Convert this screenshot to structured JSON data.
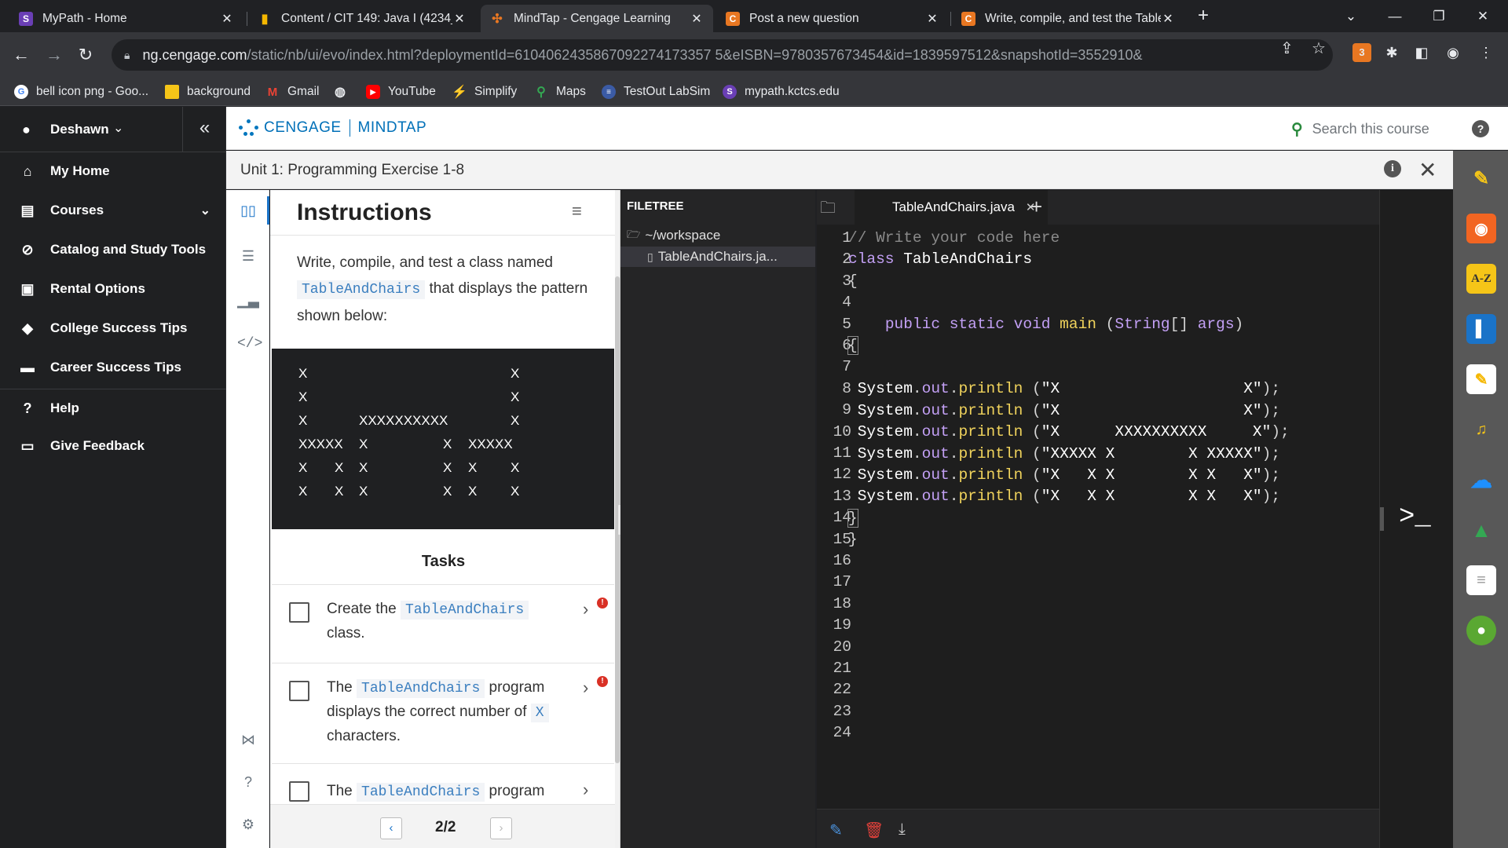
{
  "browser": {
    "tabs": [
      {
        "title": "MyPath - Home",
        "favicon": "mypath-icon",
        "active": false
      },
      {
        "title": "Content / CIT 149: Java I (4234_9",
        "favicon": "bars-icon",
        "active": false
      },
      {
        "title": "MindTap - Cengage Learning",
        "favicon": "cengage-icon",
        "active": true
      },
      {
        "title": "Post a new question",
        "favicon": "chegg-icon",
        "active": false
      },
      {
        "title": "Write, compile, and test the Table",
        "favicon": "chegg-icon",
        "active": false
      }
    ],
    "url_host": "ng.cengage.com",
    "url_path": "/static/nb/ui/evo/index.html?deploymentId=6104062435867092274173357 5&eISBN=9780357673454&id=1839597512&snapshotId=3552910&",
    "bookmarks": [
      {
        "label": "bell icon png - Goo...",
        "icon": "google-icon"
      },
      {
        "label": "background",
        "icon": "folder-icon"
      },
      {
        "label": "Gmail",
        "icon": "gmail-icon"
      },
      {
        "label": "",
        "icon": "globe-icon"
      },
      {
        "label": "YouTube",
        "icon": "youtube-icon"
      },
      {
        "label": "Simplify",
        "icon": "simplify-icon"
      },
      {
        "label": "Maps",
        "icon": "maps-icon"
      },
      {
        "label": "TestOut LabSim",
        "icon": "testout-icon"
      },
      {
        "label": "mypath.kctcs.edu",
        "icon": "mypath-icon"
      }
    ],
    "extension_badge": "3"
  },
  "leftnav": {
    "user": "Deshawn",
    "items": [
      {
        "label": "My Home",
        "icon": "home-icon"
      },
      {
        "label": "Courses",
        "icon": "book-icon"
      },
      {
        "label": "Catalog and Study Tools",
        "icon": "compass-icon"
      },
      {
        "label": "Rental Options",
        "icon": "rental-icon"
      },
      {
        "label": "College Success Tips",
        "icon": "grad-cap-icon"
      },
      {
        "label": "Career Success Tips",
        "icon": "briefcase-icon"
      },
      {
        "label": "Help",
        "icon": "help-icon"
      },
      {
        "label": "Give Feedback",
        "icon": "feedback-icon"
      }
    ]
  },
  "header": {
    "brand_1": "CENGAGE",
    "brand_2": "MINDTAP",
    "search_placeholder": "Search this course",
    "help": "?"
  },
  "subheader": {
    "title": "Unit 1: Programming Exercise 1-8"
  },
  "instructions": {
    "heading": "Instructions",
    "text_1": "Write, compile, and test a class named",
    "class_name": "TableAndChairs",
    "text_2": " that displays the pattern shown below:",
    "pattern_rows": [
      "X                         X",
      "X                         X",
      "X       XXXXXXXXXX       X",
      "XXXXX   X          X   XXXXX",
      "X    X   X          X   X    X",
      "X    X   X          X   X    X"
    ],
    "tasks_title": "Tasks",
    "tasks": [
      {
        "pre": "Create the ",
        "code": "TableAndChairs",
        "post": " class.",
        "badge": "!"
      },
      {
        "pre": "The ",
        "code": "TableAndChairs",
        "post": " program displays the correct number of ",
        "code2": "X",
        "post2": " characters.",
        "badge": "!"
      },
      {
        "pre": "The ",
        "code": "TableAndChairs",
        "post": " program",
        "badge": ""
      }
    ],
    "pager": "2/2"
  },
  "filetree": {
    "title": "FILETREE",
    "folder": "~/workspace",
    "file": "TableAndChairs.ja..."
  },
  "editor": {
    "tab": "TableAndChairs.java",
    "line_numbers": [
      "1",
      "2",
      "3",
      "4",
      "5",
      "6",
      "7",
      "8",
      "9",
      "10",
      "11",
      "12",
      "13",
      "14",
      "15",
      "16",
      "17",
      "18",
      "19",
      "20",
      "21",
      "22",
      "23",
      "24"
    ],
    "lines": [
      "// Write your code here",
      "class TableAndChairs",
      "{",
      "",
      "    public static void main (String[] args)",
      "{",
      "",
      " System.out.println (\"X                    X\");",
      " System.out.println (\"X                    X\");",
      " System.out.println (\"X      XXXXXXXXXX     X\");",
      " System.out.println (\"XXXXX X        X XXXXX\");",
      " System.out.println (\"X   X X        X X   X\");",
      " System.out.println (\"X   X X        X X   X\");",
      "}",
      "}"
    ]
  },
  "rightrail": {
    "apps": [
      "pencil-app-icon",
      "rss-app-icon",
      "az-app-icon",
      "book-app-icon",
      "notes-app-icon",
      "audio-app-icon",
      "cloud-app-icon",
      "drive-app-icon",
      "notepad-app-icon",
      "circle-app-icon"
    ],
    "az_label": "A-Z"
  },
  "terminal": {
    "prompt": ">_"
  }
}
